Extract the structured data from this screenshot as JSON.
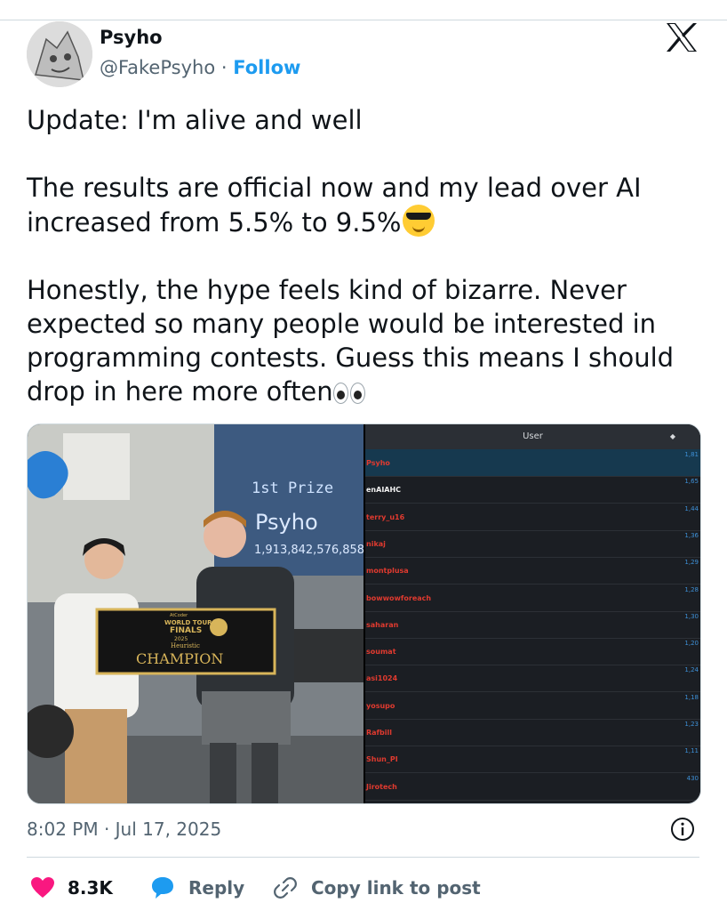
{
  "author": {
    "name": "Psyho",
    "handle": "@FakePsyho",
    "separator": "·",
    "follow_label": "Follow"
  },
  "tweet": {
    "line1": "Update: I'm alive and well",
    "para2_l1": "The results are official now and my lead over AI",
    "para2_l2": "increased from 5.5% to 9.5%",
    "para3_l1": "Honestly, the hype feels kind of bizarre. Never",
    "para3_l2": "expected so many people would be interested in",
    "para3_l3": "programming contests. Guess this means I should",
    "para3_l4": "drop in here more often",
    "emoji1": "smiling-face-with-sunglasses",
    "emoji2": "eyes"
  },
  "photo": {
    "prize_label": "1st Prize",
    "winner_name": "Psyho",
    "score": "1,913,842,576,858",
    "banner_line1": "AtCoder",
    "banner_line2": "WORLD TOUR",
    "banner_line3": "FINALS",
    "banner_line4": "2025",
    "banner_line5": "Heuristic",
    "banner_title": "CHAMPION"
  },
  "leaderboard": {
    "header": "User",
    "sort_icon": "◆",
    "rows": [
      {
        "user": "Psyho",
        "score": "1,81",
        "white": false,
        "highlight": true
      },
      {
        "user": "enAIAHC",
        "score": "1,65",
        "white": true,
        "highlight": false
      },
      {
        "user": "terry_u16",
        "score": "1,44",
        "white": false,
        "highlight": false
      },
      {
        "user": "nikaj",
        "score": "1,36",
        "white": false,
        "highlight": false
      },
      {
        "user": "montplusa",
        "score": "1,29",
        "white": false,
        "highlight": false
      },
      {
        "user": "bowwowforeach",
        "score": "1,28",
        "white": false,
        "highlight": false
      },
      {
        "user": "saharan",
        "score": "1,30",
        "white": false,
        "highlight": false
      },
      {
        "user": "soumat",
        "score": "1,20",
        "white": false,
        "highlight": false
      },
      {
        "user": "asi1024",
        "score": "1,24",
        "white": false,
        "highlight": false
      },
      {
        "user": "yosupo",
        "score": "1,18",
        "white": false,
        "highlight": false
      },
      {
        "user": "Rafbill",
        "score": "1,23",
        "white": false,
        "highlight": false
      },
      {
        "user": "Shun_PI",
        "score": "1,11",
        "white": false,
        "highlight": false
      },
      {
        "user": "Jirotech",
        "score": "430",
        "white": false,
        "highlight": false
      }
    ]
  },
  "meta": {
    "timestamp": "8:02 PM · Jul 17, 2025"
  },
  "actions": {
    "like_count": "8.3K",
    "reply_label": "Reply",
    "copy_label": "Copy link to post"
  },
  "colors": {
    "accent": "#1d9bf0",
    "like": "#f91880",
    "text": "#0f1419",
    "muted": "#536471"
  }
}
